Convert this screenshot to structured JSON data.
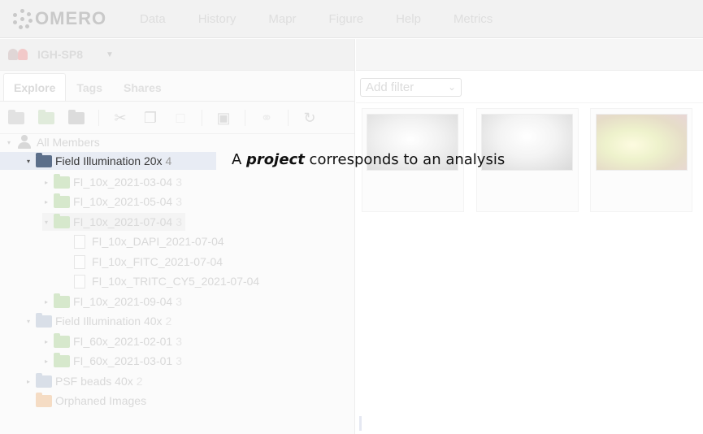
{
  "app": {
    "logo": "OMERO",
    "nav": [
      "Data",
      "History",
      "Mapr",
      "Figure",
      "Help",
      "Metrics"
    ]
  },
  "group": {
    "name": "IGH-SP8"
  },
  "tabs": [
    "Explore",
    "Tags",
    "Shares"
  ],
  "toolbar": {
    "icons": [
      "new-project-icon",
      "new-dataset-icon",
      "new-screen-icon",
      "cut-icon",
      "copy-icon",
      "paste-icon",
      "delete-icon",
      "link-icon",
      "refresh-icon"
    ]
  },
  "tree": {
    "root_label": "All Members",
    "project1": {
      "label": "Field Illumination 20x",
      "count": "4"
    },
    "p1_datasets": [
      {
        "label": "FI_10x_2021-03-04",
        "count": "3"
      },
      {
        "label": "FI_10x_2021-05-04",
        "count": "3"
      },
      {
        "label": "FI_10x_2021-07-04",
        "count": "3"
      }
    ],
    "images": [
      "FI_10x_DAPI_2021-07-04",
      "FI_10x_FITC_2021-07-04",
      "FI_10x_TRITC_CY5_2021-07-04"
    ],
    "p1_last_dataset": {
      "label": "FI_10x_2021-09-04",
      "count": "3"
    },
    "project2": {
      "label": "Field Illumination 40x",
      "count": "2"
    },
    "p2_datasets": [
      {
        "label": "FI_60x_2021-02-01",
        "count": "3"
      },
      {
        "label": "FI_60x_2021-03-01",
        "count": "3"
      }
    ],
    "project3": {
      "label": "PSF beads 40x",
      "count": "2"
    },
    "orphaned": "Orphaned Images"
  },
  "filter": {
    "placeholder": "Add filter"
  },
  "caption": {
    "prefix": "A ",
    "emphasis": "project",
    "suffix": " corresponds to an analysis"
  },
  "colors": {
    "selected_project": "#5c6f8a",
    "dataset_folder": "#d6e8cc",
    "orphaned_folder": "#f5dcc4"
  }
}
